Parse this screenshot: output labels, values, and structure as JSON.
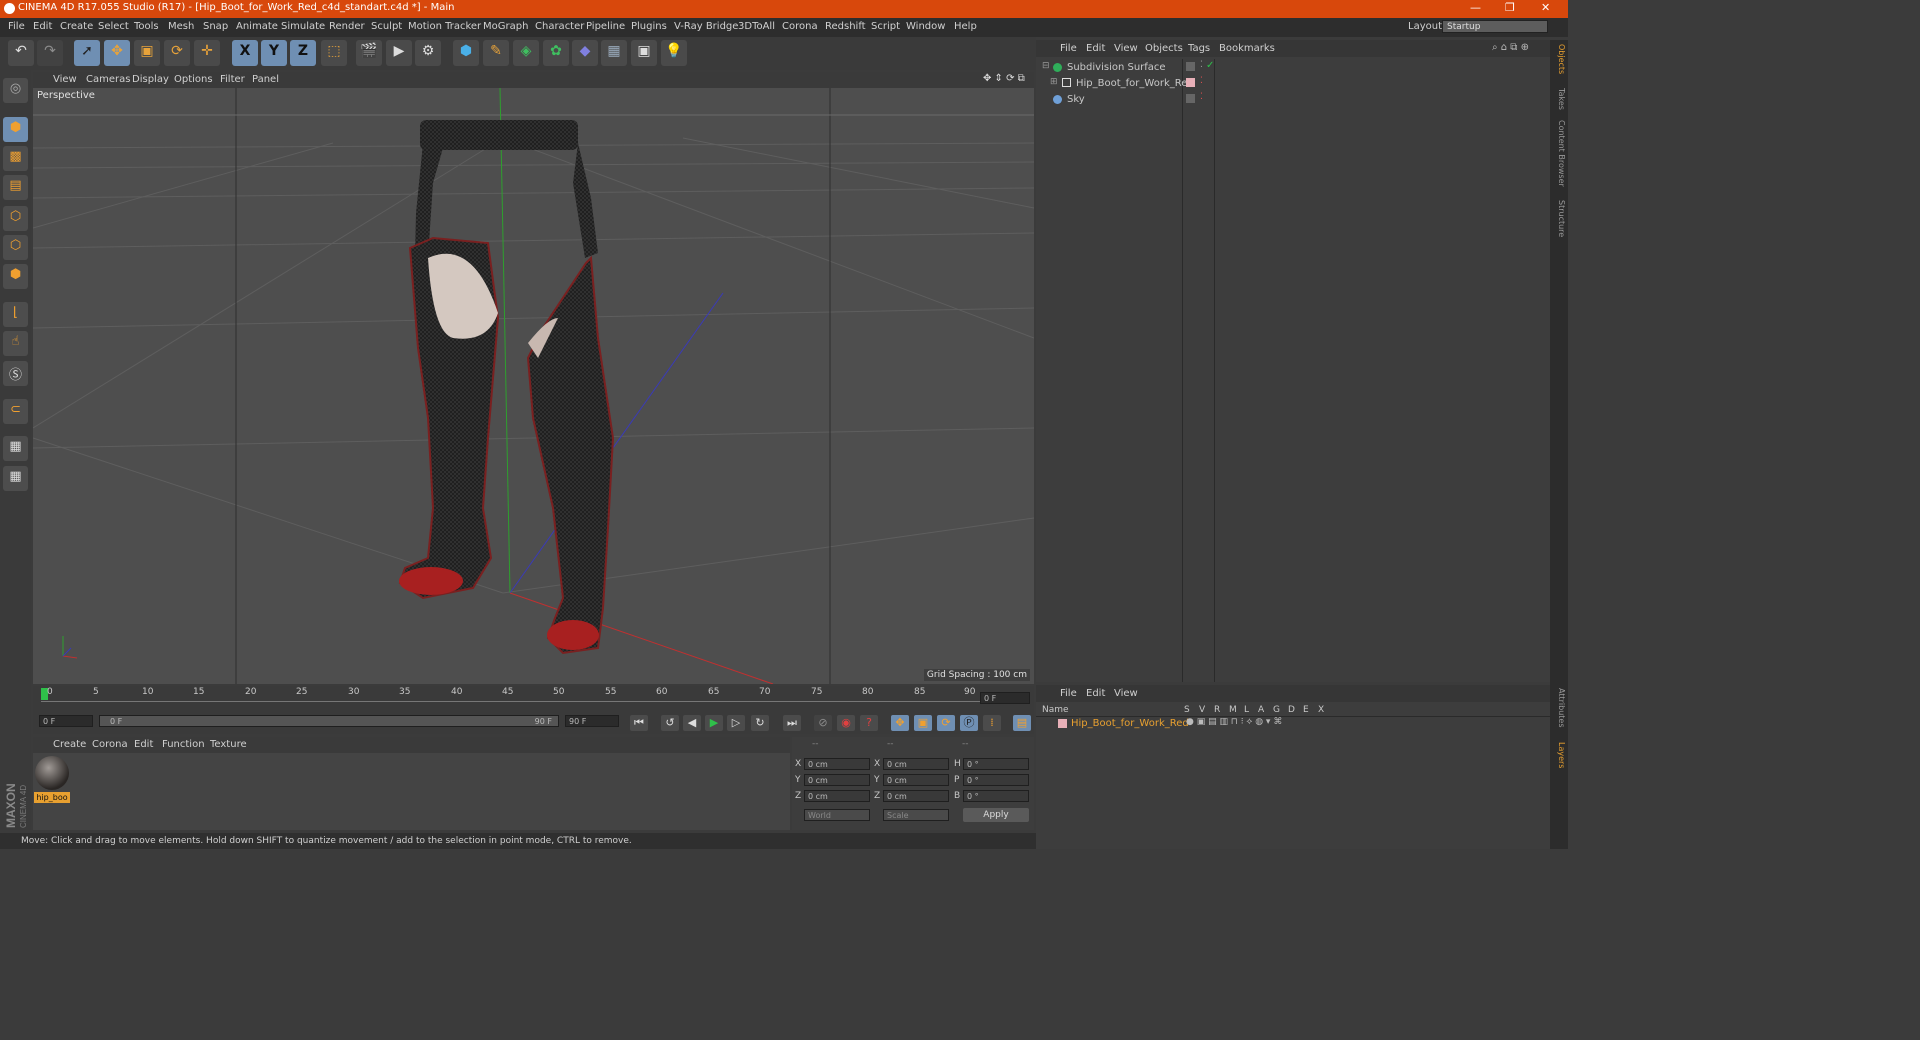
{
  "app": {
    "title": "CINEMA 4D R17.055 Studio (R17) - [Hip_Boot_for_Work_Red_c4d_standart.c4d *] - Main"
  },
  "menu": [
    "File",
    "Edit",
    "Create",
    "Select",
    "Tools",
    "Mesh",
    "Snap",
    "Animate",
    "Simulate",
    "Render",
    "Sculpt",
    "Motion Tracker",
    "MoGraph",
    "Character",
    "Pipeline",
    "Plugins",
    "V-Ray Bridge",
    "3DToAll",
    "Corona",
    "Redshift",
    "Script",
    "Window",
    "Help"
  ],
  "layout": {
    "label": "Layout:",
    "value": "Startup"
  },
  "toolbar": {
    "icons": [
      "undo-icon",
      "redo-icon",
      "select-icon",
      "move-icon",
      "scale-icon",
      "rotate-icon",
      "move-icon",
      "x-axis-icon",
      "y-axis-icon",
      "z-axis-icon",
      "coordinate-system-icon",
      "render-view-icon",
      "render-picture-viewer-icon",
      "render-settings-icon",
      "cube-icon",
      "pen-icon",
      "subdivision-icon",
      "mograph-cloner-icon",
      "deformer-icon",
      "floor-icon",
      "camera-icon",
      "light-icon"
    ],
    "axis_labels": [
      "X",
      "Y",
      "Z"
    ]
  },
  "viewport": {
    "menu": [
      "View",
      "Cameras",
      "Display",
      "Options",
      "Filter",
      "Panel"
    ],
    "label": "Perspective",
    "grid_spacing": "Grid Spacing : 100 cm"
  },
  "timeline": {
    "ticks": [
      "0",
      "5",
      "10",
      "15",
      "20",
      "25",
      "30",
      "35",
      "40",
      "45",
      "50",
      "55",
      "60",
      "65",
      "70",
      "75",
      "80",
      "85",
      "90"
    ],
    "current_frame": "0 F",
    "start": "0 F",
    "range_start": "0 F",
    "range_end": "90 F",
    "end": "90 F"
  },
  "material_manager": {
    "menu": [
      "Create",
      "Corona",
      "Edit",
      "Function",
      "Texture"
    ],
    "materials": [
      {
        "name": "hip_boo"
      }
    ]
  },
  "coordinates": {
    "headers": [
      "--",
      "--",
      "--"
    ],
    "rows": [
      {
        "a": "X",
        "av": "0 cm",
        "b": "X",
        "bv": "0 cm",
        "c": "H",
        "cv": "0 °"
      },
      {
        "a": "Y",
        "av": "0 cm",
        "b": "Y",
        "bv": "0 cm",
        "c": "P",
        "cv": "0 °"
      },
      {
        "a": "Z",
        "av": "0 cm",
        "b": "Z",
        "bv": "0 cm",
        "c": "B",
        "cv": "0 °"
      }
    ],
    "world": "World",
    "scale": "Scale",
    "apply": "Apply"
  },
  "status": "Move: Click and drag to move elements. Hold down SHIFT to quantize movement / add to the selection in point mode, CTRL to remove.",
  "object_manager": {
    "menu": [
      "File",
      "Edit",
      "View",
      "Objects",
      "Tags",
      "Bookmarks"
    ],
    "objects": [
      {
        "name": "Subdivision Surface",
        "color": "#2fae5a"
      },
      {
        "name": "Hip_Boot_for_Work_Red",
        "color": "#d9d9d9"
      },
      {
        "name": "Sky",
        "color": "#6fa0d8"
      }
    ]
  },
  "layer_manager": {
    "menu": [
      "File",
      "Edit",
      "View"
    ],
    "columns": [
      "Name",
      "S",
      "V",
      "R",
      "M",
      "L",
      "A",
      "G",
      "D",
      "E",
      "X"
    ],
    "layers": [
      {
        "name": "Hip_Boot_for_Work_Red",
        "color": "#e8a030"
      }
    ]
  },
  "right_tabs": [
    "Objects",
    "Takes",
    "Content Browser",
    "Structure",
    "Attributes",
    "Layers"
  ],
  "brand": {
    "maxon": "MAXON",
    "c4d": "CINEMA 4D"
  },
  "colors": {
    "accent": "#d8480c",
    "selected": "#6f8fb3",
    "highlight": "#e8a030"
  }
}
